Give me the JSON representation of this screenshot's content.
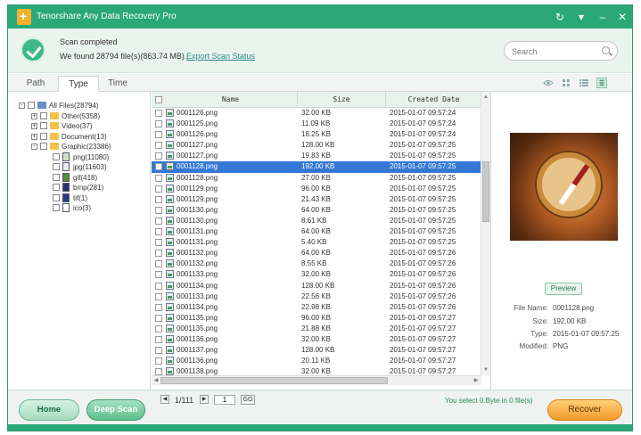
{
  "window": {
    "title": "Tenorshare Any Data Recovery Pro"
  },
  "status": {
    "title": "Scan completed",
    "found": "We found 28794 file(s)(863.74 MB).",
    "export_link": "Export Scan Status"
  },
  "search": {
    "placeholder": "Search"
  },
  "tabs": [
    {
      "label": "Path"
    },
    {
      "label": "Type",
      "active": true
    },
    {
      "label": "Time"
    }
  ],
  "tree": [
    {
      "label": "All Files(28794)",
      "level": 0,
      "expander": "-"
    },
    {
      "label": "Other(5358)",
      "level": 1,
      "expander": "+"
    },
    {
      "label": "Video(37)",
      "level": 1,
      "expander": "+"
    },
    {
      "label": "Document(13)",
      "level": 1,
      "expander": "+"
    },
    {
      "label": "Graphic(23386)",
      "level": 1,
      "expander": "-"
    },
    {
      "label": "png(11080)",
      "level": 2
    },
    {
      "label": "jpg(11603)",
      "level": 2
    },
    {
      "label": "gif(418)",
      "level": 2
    },
    {
      "label": "bmp(281)",
      "level": 2
    },
    {
      "label": "tif(1)",
      "level": 2
    },
    {
      "label": "ico(3)",
      "level": 2
    }
  ],
  "list": {
    "columns": [
      "Name",
      "Size",
      "Created Date"
    ],
    "rows": [
      {
        "name": "0001126.png",
        "size": "32.00 KB",
        "date": "2015-01-07 09:57:24"
      },
      {
        "name": "0001125.png",
        "size": "11.09 KB",
        "date": "2015-01-07 09:57:24"
      },
      {
        "name": "0001126.png",
        "size": "18.25 KB",
        "date": "2015-01-07 09:57:24"
      },
      {
        "name": "0001127.png",
        "size": "128.00 KB",
        "date": "2015-01-07 09:57:25"
      },
      {
        "name": "0001127.png",
        "size": "19.83 KB",
        "date": "2015-01-07 09:57:25"
      },
      {
        "name": "0001128.png",
        "size": "192.00 KB",
        "date": "2015-01-07 09:57:25",
        "selected": true
      },
      {
        "name": "0001128.png",
        "size": "27.00 KB",
        "date": "2015-01-07 09:57:25"
      },
      {
        "name": "0001129.png",
        "size": "96.00 KB",
        "date": "2015-01-07 09:57:25"
      },
      {
        "name": "0001129.png",
        "size": "21.43 KB",
        "date": "2015-01-07 09:57:25"
      },
      {
        "name": "0001130.png",
        "size": "64.00 KB",
        "date": "2015-01-07 09:57:25"
      },
      {
        "name": "0001130.png",
        "size": "8.61 KB",
        "date": "2015-01-07 09:57:25"
      },
      {
        "name": "0001131.png",
        "size": "64.00 KB",
        "date": "2015-01-07 09:57:25"
      },
      {
        "name": "0001131.png",
        "size": "5.40 KB",
        "date": "2015-01-07 09:57:25"
      },
      {
        "name": "0001132.png",
        "size": "64.00 KB",
        "date": "2015-01-07 09:57:26"
      },
      {
        "name": "0001132.png",
        "size": "8.55 KB",
        "date": "2015-01-07 09:57:26"
      },
      {
        "name": "0001133.png",
        "size": "32.00 KB",
        "date": "2015-01-07 09:57:26"
      },
      {
        "name": "0001134.png",
        "size": "128.00 KB",
        "date": "2015-01-07 09:57:26"
      },
      {
        "name": "0001133.png",
        "size": "22.56 KB",
        "date": "2015-01-07 09:57:26"
      },
      {
        "name": "0001134.png",
        "size": "22.98 KB",
        "date": "2015-01-07 09:57:26"
      },
      {
        "name": "0001135.png",
        "size": "96.00 KB",
        "date": "2015-01-07 09:57:27"
      },
      {
        "name": "0001135.png",
        "size": "21.88 KB",
        "date": "2015-01-07 09:57:27"
      },
      {
        "name": "0001136.png",
        "size": "32.00 KB",
        "date": "2015-01-07 09:57:27"
      },
      {
        "name": "0001137.png",
        "size": "128.00 KB",
        "date": "2015-01-07 09:57:27"
      },
      {
        "name": "0001136.png",
        "size": "20.11 KB",
        "date": "2015-01-07 09:57:27"
      },
      {
        "name": "0001138.png",
        "size": "32.00 KB",
        "date": "2015-01-07 09:57:27"
      }
    ]
  },
  "preview": {
    "button": "Preview",
    "meta": [
      {
        "key": "File Name:",
        "value": "0001128.png"
      },
      {
        "key": "Size:",
        "value": "192.00 KB"
      },
      {
        "key": "Type:",
        "value": "2015-01-07 09:57:25"
      },
      {
        "key": "Modified:",
        "value": "PNG"
      }
    ]
  },
  "pager": {
    "page": "1/111",
    "input": "1",
    "go": "GO"
  },
  "bottom": {
    "home": "Home",
    "deep_scan": "Deep Scan",
    "select_info": "You select 0.Byte in 0 file(s)",
    "recover": "Recover"
  },
  "colors": {
    "accent": "#2aa878",
    "selected_row": "#3478d6",
    "recover": "#f39a2a"
  },
  "icons": {
    "app": "app-logo-icon",
    "titlebar": [
      "refresh-icon",
      "dropdown-icon",
      "minimize-icon",
      "close-icon"
    ],
    "views": [
      "eye-icon",
      "grid-view-icon",
      "list-view-icon",
      "detail-view-icon"
    ]
  }
}
